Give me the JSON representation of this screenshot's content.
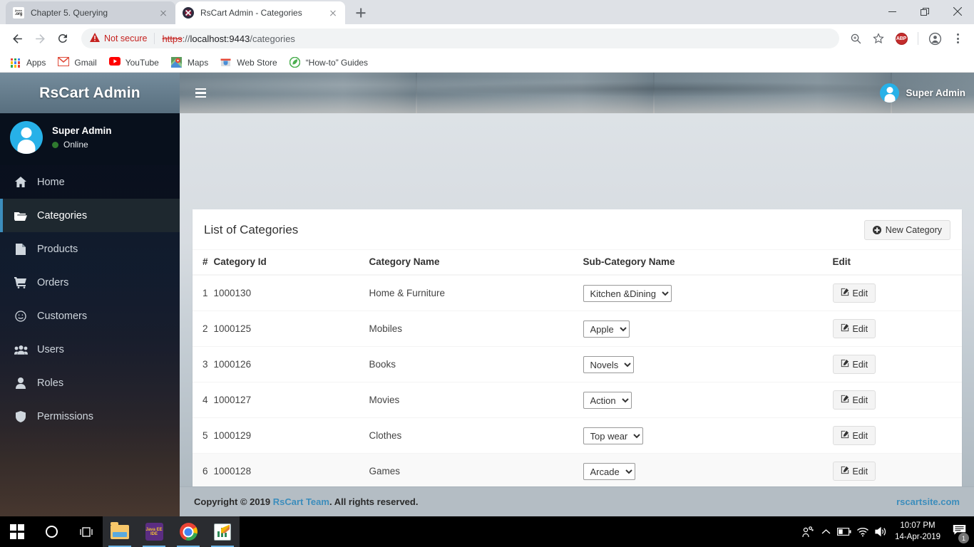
{
  "browser": {
    "tabs": [
      {
        "title": "Chapter 5. Querying",
        "favicon": "jboss-favicon",
        "active": false
      },
      {
        "title": "RsCart Admin - Categories",
        "favicon": "rscart-favicon",
        "active": true
      }
    ],
    "new_tab_label": "New tab",
    "window_controls": {
      "minimize": "minimize-icon",
      "maximize": "maximize-icon",
      "close": "close-icon"
    },
    "omnibox": {
      "security_label": "Not secure",
      "url_scheme": "https",
      "url_separator": "://",
      "url_host": "localhost:9443",
      "url_path": "/categories",
      "full_url": "https://localhost:9443/categories"
    },
    "toolbar_icons": {
      "back": "back-arrow-icon",
      "forward": "forward-arrow-icon",
      "reload": "reload-icon",
      "zoom": "zoom-icon",
      "bookmark": "star-icon",
      "extension": "ABP",
      "profile": "profile-avatar-icon",
      "menu": "three-dot-menu-icon"
    },
    "bookmarks": [
      {
        "label": "Apps",
        "icon": "apps-grid-icon"
      },
      {
        "label": "Gmail",
        "icon": "gmail-icon"
      },
      {
        "label": "YouTube",
        "icon": "youtube-icon"
      },
      {
        "label": "Maps",
        "icon": "google-maps-icon"
      },
      {
        "label": "Web Store",
        "icon": "chrome-web-store-icon"
      },
      {
        "label": "“How-to” Guides",
        "icon": "how-to-guides-icon"
      }
    ]
  },
  "app": {
    "brand": "RsCart Admin",
    "sidebar": {
      "profile": {
        "name": "Super Admin",
        "status": "Online",
        "status_color": "#2f7a2f",
        "avatar": "user-avatar-icon"
      },
      "items": [
        {
          "label": "Home",
          "icon": "home-icon",
          "active": false
        },
        {
          "label": "Categories",
          "icon": "folder-open-icon",
          "active": true
        },
        {
          "label": "Products",
          "icon": "file-icon",
          "active": false
        },
        {
          "label": "Orders",
          "icon": "shopping-cart-icon",
          "active": false
        },
        {
          "label": "Customers",
          "icon": "smiley-face-icon",
          "active": false
        },
        {
          "label": "Users",
          "icon": "users-group-icon",
          "active": false
        },
        {
          "label": "Roles",
          "icon": "user-icon",
          "active": false
        },
        {
          "label": "Permissions",
          "icon": "shield-icon",
          "active": false
        }
      ],
      "active_accent": "#3c8dbc"
    },
    "topnav": {
      "menu_toggle": "hamburger-icon",
      "user_name": "Super Admin",
      "user_avatar": "user-avatar-icon"
    },
    "card": {
      "title": "List of Categories",
      "new_button": {
        "label": "New Category",
        "icon": "plus-circle-icon"
      },
      "columns": [
        "#",
        "Category Id",
        "Category Name",
        "Sub-Category Name",
        "Edit"
      ],
      "rows": [
        {
          "num": "1",
          "id": "1000130",
          "name": "Home & Furniture",
          "sub": "Kitchen &Dining",
          "edit": "Edit"
        },
        {
          "num": "2",
          "id": "1000125",
          "name": "Mobiles",
          "sub": "Apple",
          "edit": "Edit"
        },
        {
          "num": "3",
          "id": "1000126",
          "name": "Books",
          "sub": "Novels",
          "edit": "Edit"
        },
        {
          "num": "4",
          "id": "1000127",
          "name": "Movies",
          "sub": "Action",
          "edit": "Edit"
        },
        {
          "num": "5",
          "id": "1000129",
          "name": "Clothes",
          "sub": "Top wear",
          "edit": "Edit"
        },
        {
          "num": "6",
          "id": "1000128",
          "name": "Games",
          "sub": "Arcade",
          "edit": "Edit"
        }
      ],
      "edit_icon": "edit-pencil-icon"
    },
    "footer": {
      "copyright_prefix": "Copyright © 2019 ",
      "team_link": "RsCart Team",
      "copyright_suffix": ". All rights reserved.",
      "site_link": "rscartsite.com",
      "link_color": "#3c8dbc"
    }
  },
  "taskbar": {
    "items": [
      {
        "name": "start-button",
        "icon": "windows-logo-icon",
        "open": false
      },
      {
        "name": "cortana-search-button",
        "icon": "circle-icon",
        "open": false
      },
      {
        "name": "task-view-button",
        "icon": "task-view-icon",
        "open": false
      },
      {
        "name": "file-explorer-button",
        "icon": "folder-icon",
        "open": true
      },
      {
        "name": "java-ee-ide-button",
        "icon": "javaee-ide-icon",
        "open": true,
        "label": "Java EE IDE"
      },
      {
        "name": "chrome-button",
        "icon": "chrome-icon",
        "open": true
      },
      {
        "name": "editor-button",
        "icon": "editor-icon",
        "open": true
      }
    ],
    "tray": {
      "people": "people-icon",
      "show_hidden": "chevron-up-icon",
      "battery": "battery-icon",
      "network": "wifi-icon",
      "volume": "speaker-icon",
      "time": "10:07 PM",
      "date": "14-Apr-2019",
      "notifications": "notification-icon",
      "notification_count": "1"
    }
  }
}
